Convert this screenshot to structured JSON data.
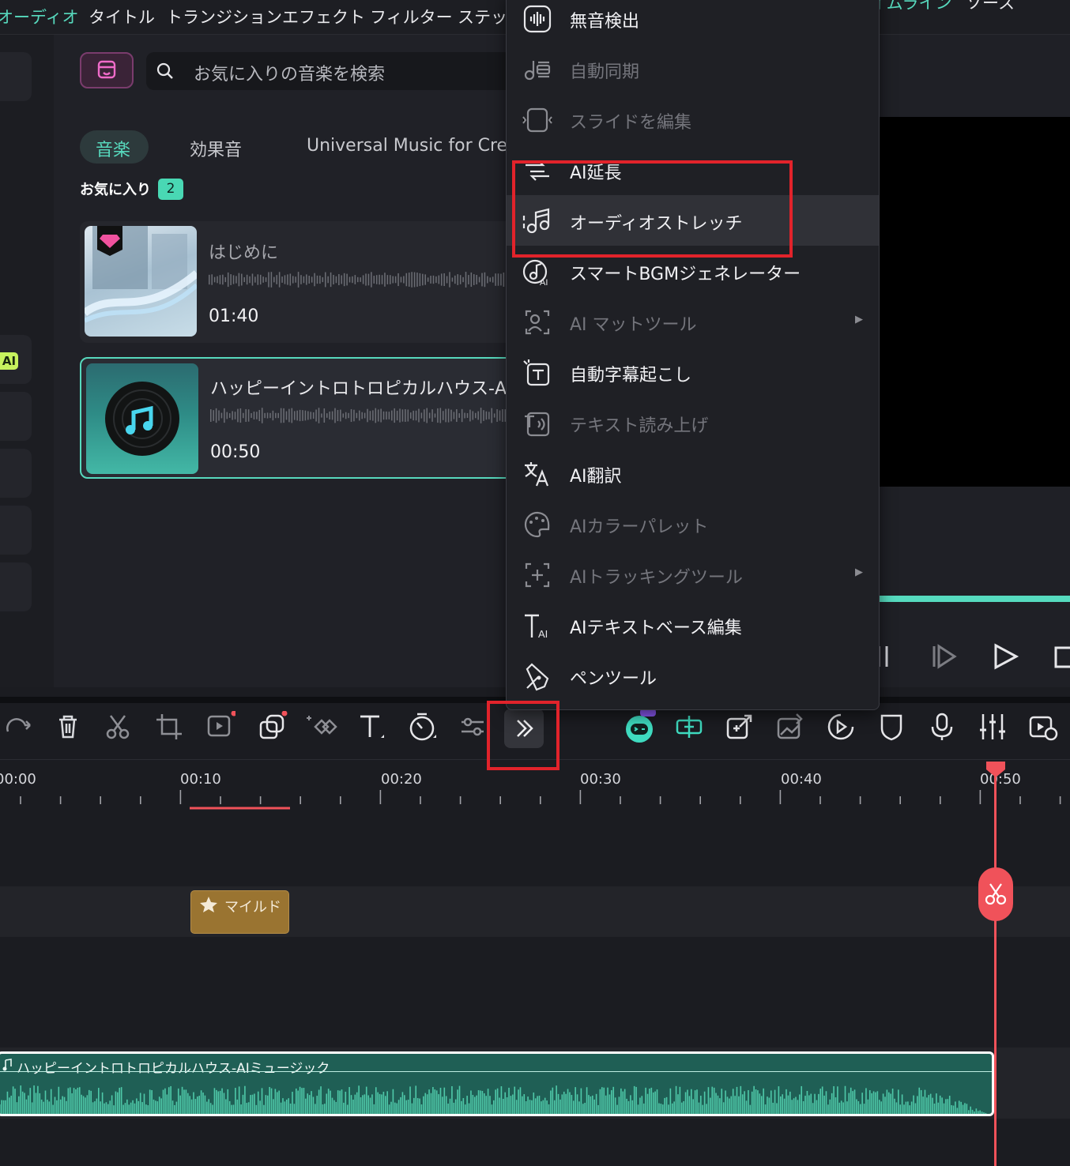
{
  "top_menu": {
    "items": [
      "オーディオ",
      "タイトル",
      "トランジション",
      "エフェクト",
      "フィルター",
      "ステッカー"
    ],
    "right_items": [
      "タイムライン",
      "ソース"
    ]
  },
  "library": {
    "search_placeholder": "お気に入りの音楽を検索",
    "tabs": [
      "音楽",
      "効果音",
      "Universal Music for Creators"
    ],
    "favorites_label": "お気に入り",
    "favorites_count": "2",
    "ai_badge": "AI",
    "cards": [
      {
        "title": "はじめに",
        "duration": "01:40"
      },
      {
        "title": "ハッピーイントロトロピカルハウス-AIミュージック",
        "duration": "00:50"
      }
    ]
  },
  "dropdown": {
    "items": [
      {
        "label": "無音検出",
        "icon": "waveform-icon",
        "enabled": true
      },
      {
        "label": "自動同期",
        "icon": "sync-icon",
        "enabled": false
      },
      {
        "label": "スライドを編集",
        "icon": "slide-icon",
        "enabled": false
      },
      {
        "label": "AI延長",
        "icon": "ai-extend-icon",
        "enabled": true
      },
      {
        "label": "オーディオストレッチ",
        "icon": "audio-stretch-icon",
        "enabled": true,
        "highlighted": true
      },
      {
        "label": "スマートBGMジェネレーター",
        "icon": "smart-bgm-icon",
        "enabled": true
      },
      {
        "label": "AI マットツール",
        "icon": "ai-matte-icon",
        "enabled": false,
        "submenu": true
      },
      {
        "label": "自動字幕起こし",
        "icon": "auto-caption-icon",
        "enabled": true
      },
      {
        "label": "テキスト読み上げ",
        "icon": "text-to-speech-icon",
        "enabled": false
      },
      {
        "label": "AI翻訳",
        "icon": "ai-translate-icon",
        "enabled": true
      },
      {
        "label": "AIカラーパレット",
        "icon": "ai-color-palette-icon",
        "enabled": false
      },
      {
        "label": "AIトラッキングツール",
        "icon": "ai-tracking-icon",
        "enabled": false,
        "submenu": true
      },
      {
        "label": "AIテキストベース編集",
        "icon": "ai-text-edit-icon",
        "enabled": true
      },
      {
        "label": "ペンツール",
        "icon": "pen-tool-icon",
        "enabled": true
      }
    ]
  },
  "timeline": {
    "ruler_labels": [
      "00:00",
      "00:10",
      "00:20",
      "00:30",
      "00:40",
      "00:50"
    ],
    "effect_clip_label": "マイルド",
    "audio_clip_label": "ハッピーイントロトロピカルハウス-AIミュージック"
  },
  "colors": {
    "accent": "#57d9bd",
    "playhead": "#f0525a",
    "highlight_box": "#e2232b",
    "effect_clip": "#9a7431"
  }
}
